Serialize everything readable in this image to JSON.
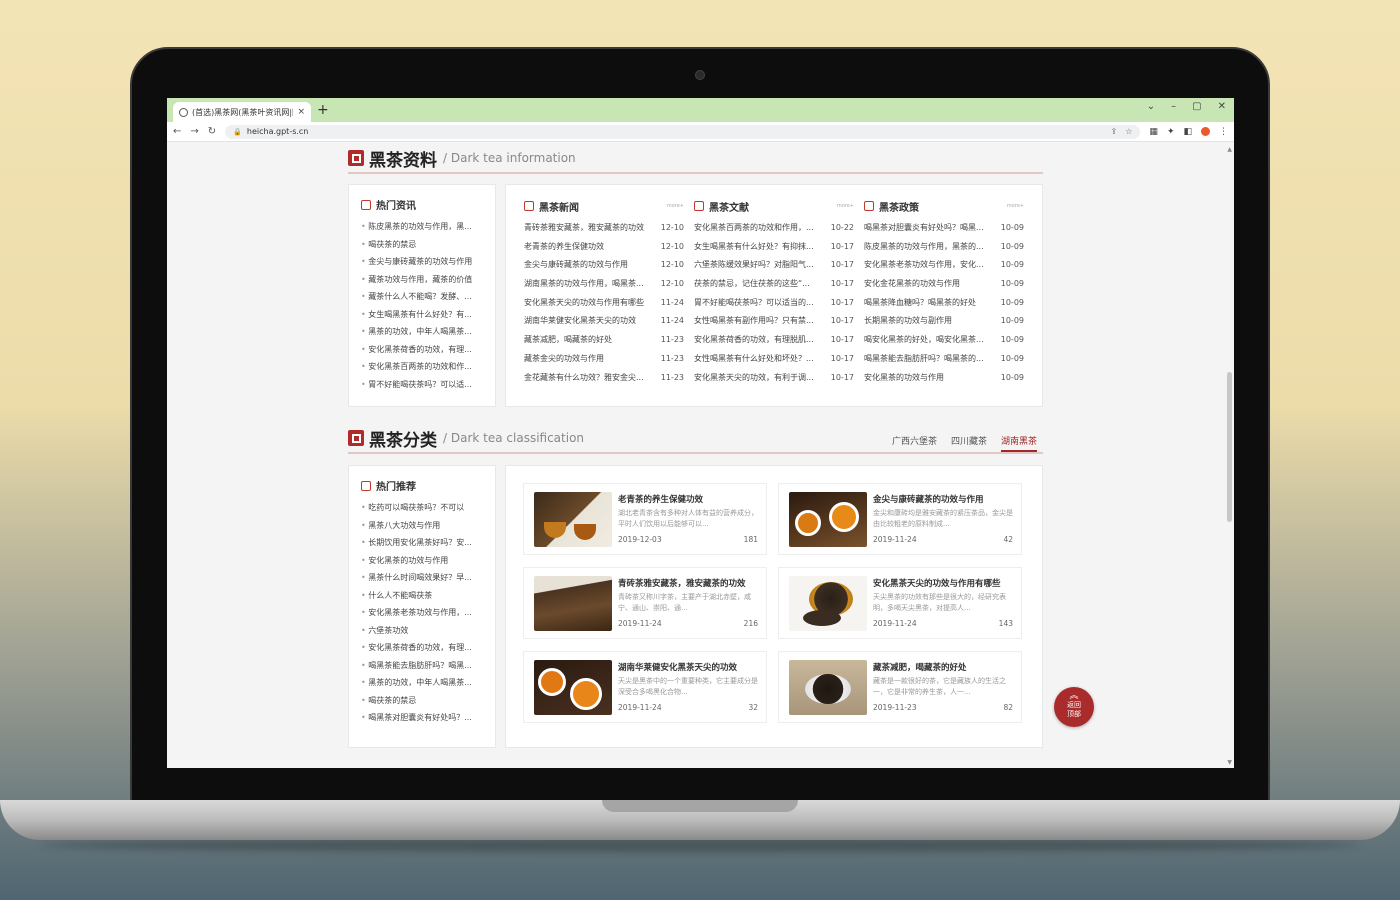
{
  "browser": {
    "tab_title": "(首选)黑茶网(黑茶叶资讯网|网站...",
    "tab_close": "×",
    "new_tab": "+",
    "url": "heicha.gpt-s.cn",
    "window_controls": [
      "⌄",
      "–",
      "▢",
      "✕"
    ]
  },
  "section1": {
    "title": "黑茶资料",
    "subtitle": "/ Dark tea information",
    "hot_news": {
      "title": "热门资讯",
      "items": [
        "陈皮黑茶的功效与作用，黑...",
        "喝茯茶的禁忌",
        "金尖与康砖藏茶的功效与作用",
        "藏茶功效与作用，藏茶的价值",
        "藏茶什么人不能喝？发酵、...",
        "女生喝黑茶有什么好处？有...",
        "黑茶的功效，中年人喝黑茶...",
        "安化黑茶荷香的功效，有理...",
        "安化黑茶百两茶的功效和作...",
        "胃不好能喝茯茶吗？可以适..."
      ]
    },
    "columns": [
      {
        "title": "黑茶新闻",
        "more": "more+",
        "rows": [
          {
            "t": "青砖茶雅安藏茶，雅安藏茶的功效",
            "d": "12-10"
          },
          {
            "t": "老青茶的养生保健功效",
            "d": "12-10"
          },
          {
            "t": "金尖与康砖藏茶的功效与作用",
            "d": "12-10"
          },
          {
            "t": "湖南黑茶的功效与作用，喝黑茶...",
            "d": "12-10"
          },
          {
            "t": "安化黑茶天尖的功效与作用有哪些",
            "d": "11-24"
          },
          {
            "t": "湖南华莱健安化黑茶天尖的功效",
            "d": "11-24"
          },
          {
            "t": "藏茶减肥，喝藏茶的好处",
            "d": "11-23"
          },
          {
            "t": "藏茶金尖的功效与作用",
            "d": "11-23"
          },
          {
            "t": "金花藏茶有什么功效？雅安金尖...",
            "d": "11-23"
          }
        ]
      },
      {
        "title": "黑茶文献",
        "more": "more+",
        "rows": [
          {
            "t": "安化黑茶百两茶的功效和作用，...",
            "d": "10-22"
          },
          {
            "t": "女生喝黑茶有什么好处？有抑抹...",
            "d": "10-17"
          },
          {
            "t": "六堡茶陈缓效果好吗？对脂阳气...",
            "d": "10-17"
          },
          {
            "t": "茯茶的禁忌，记住茯茶的这些“...",
            "d": "10-17"
          },
          {
            "t": "胃不好能喝茯茶吗？可以适当的...",
            "d": "10-17"
          },
          {
            "t": "女性喝黑茶有副作用吗？只有禁...",
            "d": "10-17"
          },
          {
            "t": "安化黑茶荷香的功效，有理脱肌...",
            "d": "10-17"
          },
          {
            "t": "女性喝黑茶有什么好处和坏处？...",
            "d": "10-17"
          },
          {
            "t": "安化黑茶天尖的功效，有利于调...",
            "d": "10-17"
          }
        ]
      },
      {
        "title": "黑茶政策",
        "more": "more+",
        "rows": [
          {
            "t": "喝黑茶对胆囊炎有好处吗？喝黑...",
            "d": "10-09"
          },
          {
            "t": "陈皮黑茶的功效与作用，黑茶的...",
            "d": "10-09"
          },
          {
            "t": "安化黑茶老茶功效与作用，安化...",
            "d": "10-09"
          },
          {
            "t": "安化金花黑茶的功效与作用",
            "d": "10-09"
          },
          {
            "t": "喝黑茶降血糖吗？喝黑茶的好处",
            "d": "10-09"
          },
          {
            "t": "长期黑茶的功效与副作用",
            "d": "10-09"
          },
          {
            "t": "喝安化黑茶的好处，喝安化黑茶...",
            "d": "10-09"
          },
          {
            "t": "喝黑茶能去脂肪肝吗？喝黑茶的...",
            "d": "10-09"
          },
          {
            "t": "安化黑茶的功效与作用",
            "d": "10-09"
          }
        ]
      }
    ]
  },
  "section2": {
    "title": "黑茶分类",
    "subtitle": "/ Dark tea classification",
    "tabs": [
      "广西六堡茶",
      "四川藏茶",
      "湖南黑茶"
    ],
    "active_tab": "湖南黑茶",
    "hot_recommend": {
      "title": "热门推荐",
      "items": [
        "吃药可以喝茯茶吗？不可以",
        "黑茶八大功效与作用",
        "长期饮用安化黑茶好吗？安...",
        "安化黑茶的功效与作用",
        "黑茶什么时间喝效果好？早...",
        "什么人不能喝茯茶",
        "安化黑茶老茶功效与作用，...",
        "六堡茶功效",
        "安化黑茶荷香的功效，有理...",
        "喝黑茶能去脂肪肝吗？喝黑...",
        "黑茶的功效，中年人喝黑茶...",
        "喝茯茶的禁忌",
        "喝黑茶对胆囊炎有好处吗？..."
      ]
    },
    "views_label": "浏览：",
    "cards": [
      {
        "title": "老青茶的养生保健功效",
        "desc": "湖北老青茶含有多种对人体有益的营养成分，平时人们饮用以后能够可以...",
        "date": "2019-12-03",
        "views": "181"
      },
      {
        "title": "金尖与康砖藏茶的功效与作用",
        "desc": "金尖和康砖均是雅安藏茶的紧压茶品，金尖是由比较粗老的原料制成...",
        "date": "2019-11-24",
        "views": "42"
      },
      {
        "title": "青砖茶雅安藏茶，雅安藏茶的功效",
        "desc": "青砖茶又称川字茶，主要产于湖北赤壁，咸宁、通山、崇阳、通...",
        "date": "2019-11-24",
        "views": "216"
      },
      {
        "title": "安化黑茶天尖的功效与作用有哪些",
        "desc": "天尖黑茶的功效有那些是很大的，经研究表明，多喝天尖黑茶，对提高人...",
        "date": "2019-11-24",
        "views": "143"
      },
      {
        "title": "湖南华莱健安化黑茶天尖的功效",
        "desc": "天尖是黑茶中的一个重要种类，它主要成分是深受合多喝黑化合物...",
        "date": "2019-11-24",
        "views": "32"
      },
      {
        "title": "藏茶减肥，喝藏茶的好处",
        "desc": "藏茶是一款很好的茶，它是藏族人的生活之一，它是非常的养生茶，人一...",
        "date": "2019-11-23",
        "views": "82"
      }
    ]
  },
  "back_to_top": {
    "arrow": "︽",
    "line1": "返回",
    "line2": "顶部"
  },
  "colors": {
    "accent": "#a92b2b",
    "titlebar": "#c8e6b4"
  }
}
